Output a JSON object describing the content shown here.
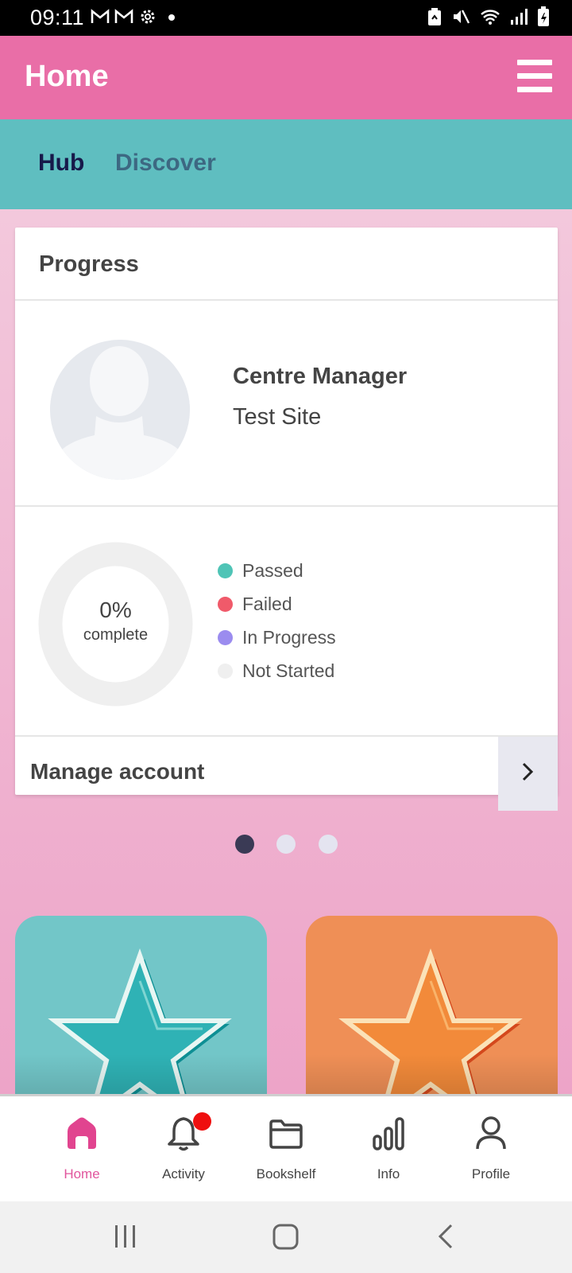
{
  "status_bar": {
    "time": "09:11",
    "left_icons": [
      "gmail-icon",
      "gmail-icon",
      "settings-icon",
      "notification-dot-icon"
    ],
    "right_icons": [
      "recycle-icon",
      "mute-icon",
      "wifi-icon",
      "signal-icon",
      "battery-charging-icon"
    ]
  },
  "app_bar": {
    "title": "Home",
    "menu_icon": "hamburger-menu-icon",
    "color": "#e96ea7"
  },
  "tabs": [
    {
      "label": "Hub",
      "active": true
    },
    {
      "label": "Discover",
      "active": false
    }
  ],
  "progress_card": {
    "title": "Progress",
    "profile": {
      "role": "Centre Manager",
      "site": "Test Site",
      "avatar_icon": "user-silhouette-icon"
    },
    "completion": {
      "percent_label": "0%",
      "caption": "complete",
      "value": 0
    },
    "legend": [
      {
        "label": "Passed",
        "color": "#4fc4b6"
      },
      {
        "label": "Failed",
        "color": "#f05a6a"
      },
      {
        "label": "In Progress",
        "color": "#9b8cef"
      },
      {
        "label": "Not Started",
        "color": "#efefef"
      }
    ],
    "manage_account": {
      "label": "Manage account",
      "icon": "chevron-right-icon"
    }
  },
  "carousel": {
    "page_count": 3,
    "active_index": 0,
    "active_color": "#3a3a55",
    "inactive_color": "#e4e4f0"
  },
  "tiles": [
    {
      "name": "teal-star-tile",
      "color": "#72c6c8",
      "icon": "star-icon"
    },
    {
      "name": "orange-star-tile",
      "color": "#ef8f56",
      "icon": "star-icon"
    }
  ],
  "bottom_nav": {
    "items": [
      {
        "label": "Home",
        "icon": "home-icon",
        "active": true
      },
      {
        "label": "Activity",
        "icon": "bell-icon",
        "active": false,
        "badge": true
      },
      {
        "label": "Bookshelf",
        "icon": "folder-icon",
        "active": false
      },
      {
        "label": "Info",
        "icon": "bar-chart-icon",
        "active": false
      },
      {
        "label": "Profile",
        "icon": "person-icon",
        "active": false
      }
    ],
    "active_color": "#e1559d"
  },
  "system_nav": [
    "recent-apps-icon",
    "home-button-icon",
    "back-icon"
  ]
}
